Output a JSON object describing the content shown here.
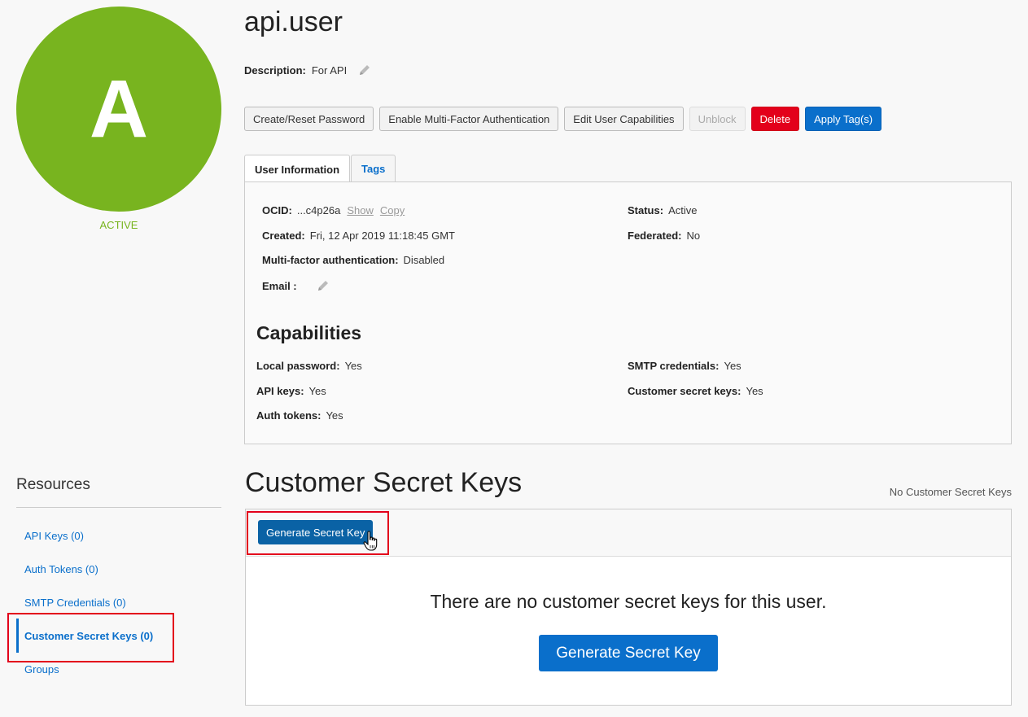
{
  "avatar": {
    "letter": "A",
    "status": "ACTIVE",
    "color": "#78b41f"
  },
  "user": {
    "name": "api.user",
    "description_label": "Description:",
    "description_value": "For API"
  },
  "actions": {
    "create_reset_password": "Create/Reset Password",
    "enable_mfa": "Enable Multi-Factor Authentication",
    "edit_capabilities": "Edit User Capabilities",
    "unblock": "Unblock",
    "delete": "Delete",
    "apply_tags": "Apply Tag(s)"
  },
  "tabs": [
    {
      "label": "User Information"
    },
    {
      "label": "Tags"
    }
  ],
  "info": {
    "ocid_label": "OCID:",
    "ocid_value": "...c4p26a",
    "show": "Show",
    "copy": "Copy",
    "created_label": "Created:",
    "created_value": "Fri, 12 Apr 2019 11:18:45 GMT",
    "mfa_label": "Multi-factor authentication:",
    "mfa_value": "Disabled",
    "email_label": "Email :",
    "status_label": "Status:",
    "status_value": "Active",
    "federated_label": "Federated:",
    "federated_value": "No"
  },
  "capabilities": {
    "title": "Capabilities",
    "local_password_label": "Local password:",
    "local_password_value": "Yes",
    "api_keys_label": "API keys:",
    "api_keys_value": "Yes",
    "auth_tokens_label": "Auth tokens:",
    "auth_tokens_value": "Yes",
    "smtp_label": "SMTP credentials:",
    "smtp_value": "Yes",
    "csk_label": "Customer secret keys:",
    "csk_value": "Yes"
  },
  "resources": {
    "title": "Resources",
    "items": [
      {
        "label": "API Keys (0)"
      },
      {
        "label": "Auth Tokens (0)"
      },
      {
        "label": "SMTP Credentials (0)"
      },
      {
        "label": "Customer Secret Keys (0)"
      },
      {
        "label": "Groups"
      }
    ]
  },
  "secret_keys": {
    "title": "Customer Secret Keys",
    "count_text": "No Customer Secret Keys",
    "generate_small": "Generate Secret Key",
    "empty_message": "There are no customer secret keys for this user.",
    "generate_big": "Generate Secret Key"
  }
}
